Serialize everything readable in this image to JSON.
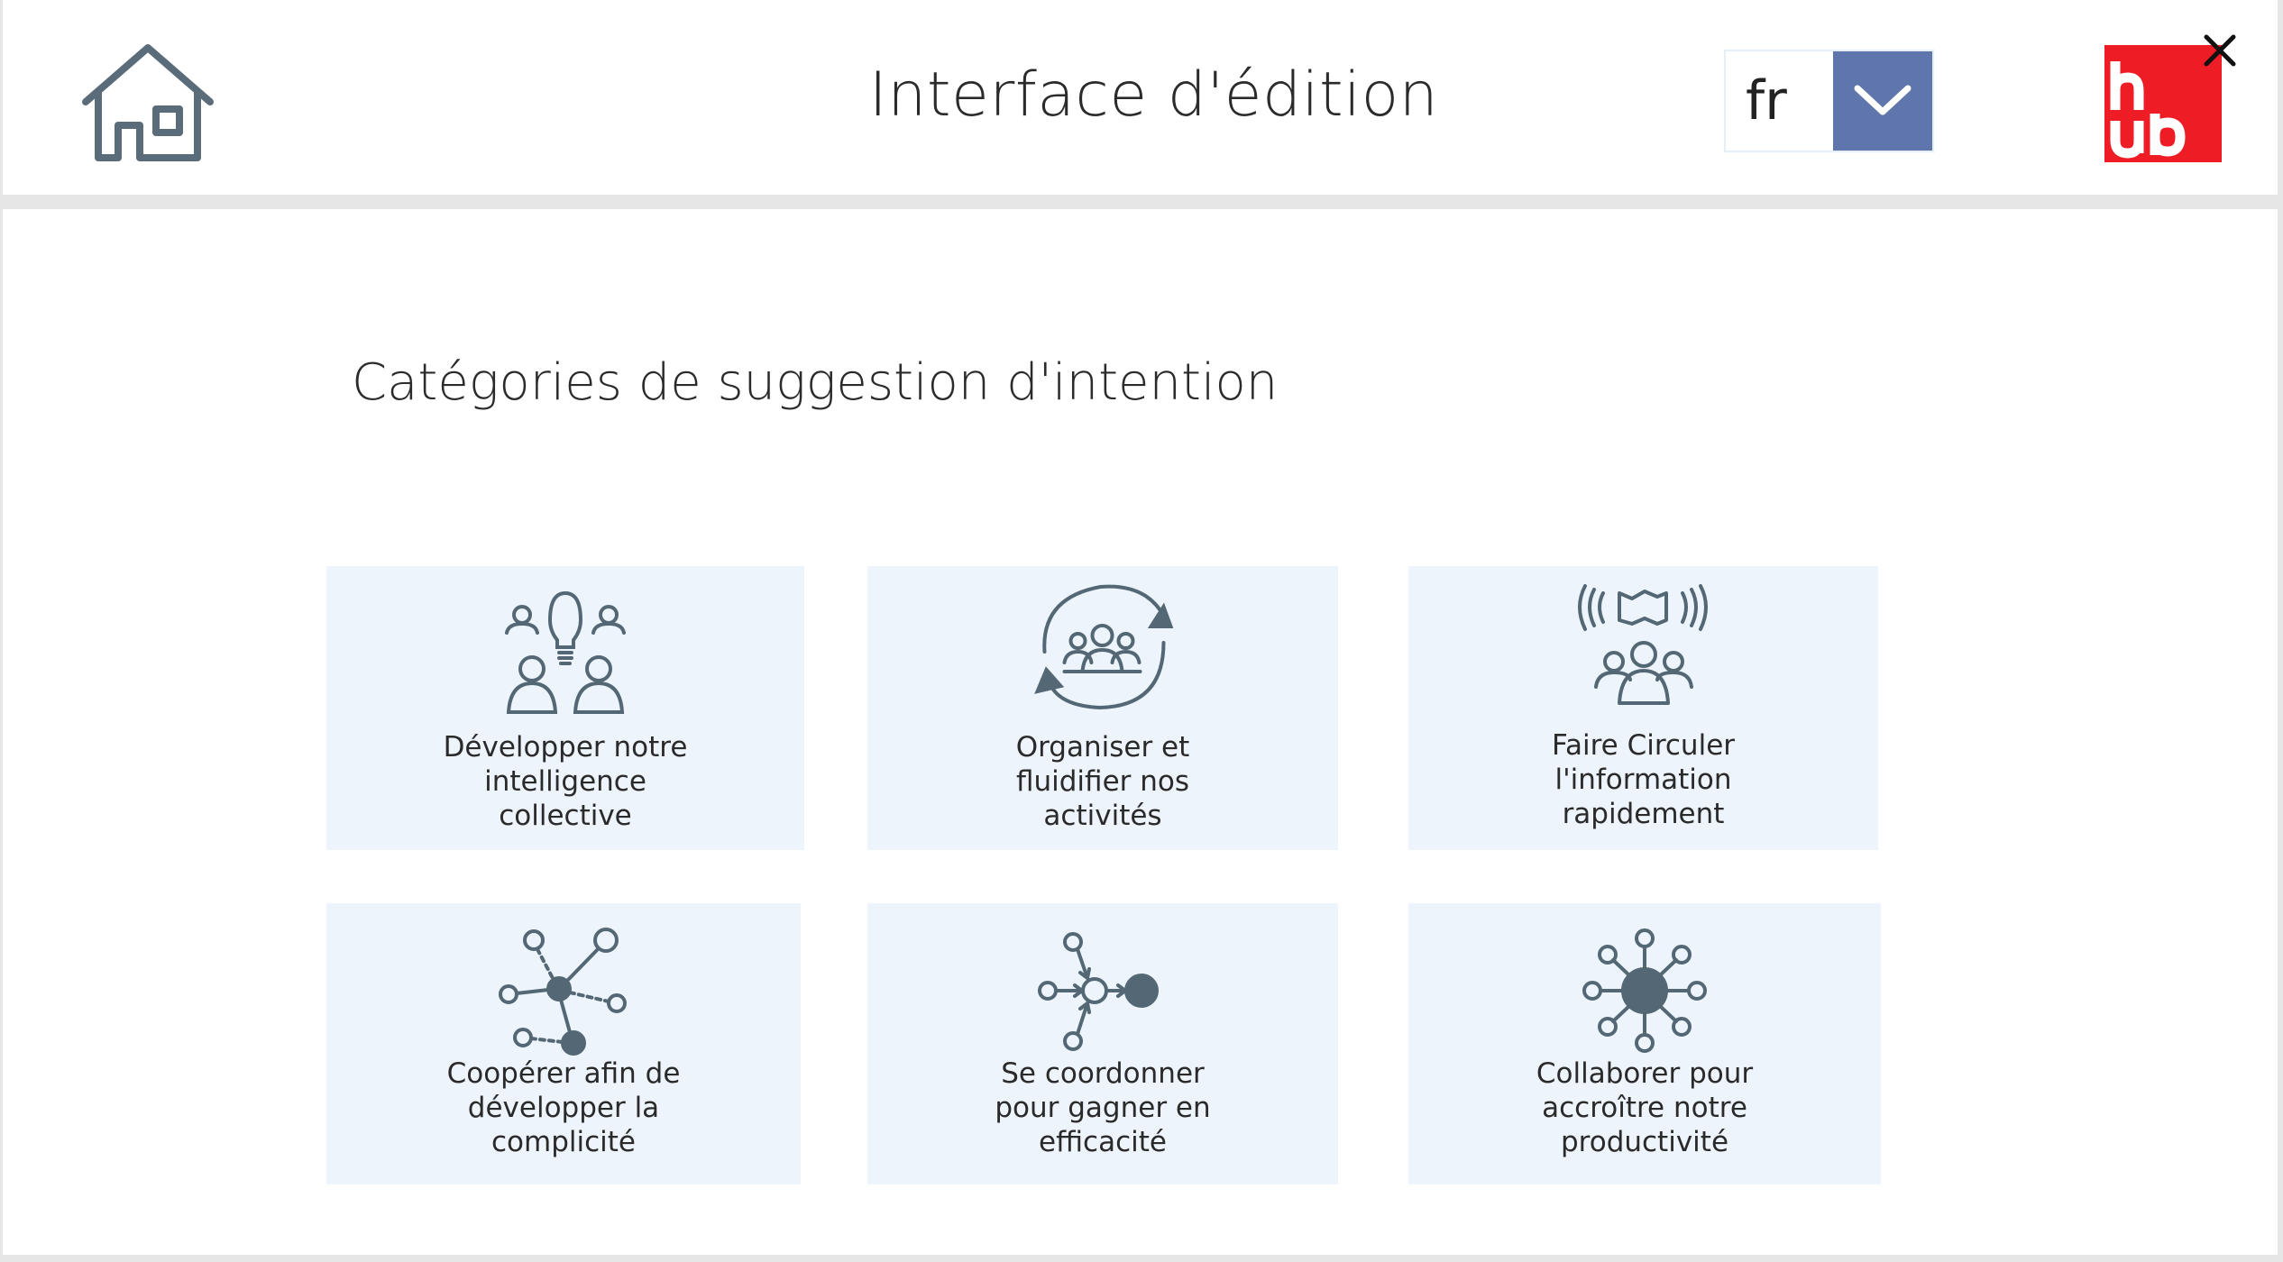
{
  "header": {
    "title": "Interface d'édition",
    "language": {
      "selected": "fr"
    },
    "logo_text": "hub"
  },
  "main": {
    "section_title": "Catégories de suggestion d'intention",
    "categories": [
      {
        "label": "Développer notre\nintelligence\ncollective",
        "icon": "collective-intelligence-icon"
      },
      {
        "label": "Organiser et\nfluidifier nos\nactivités",
        "icon": "organize-cycle-icon"
      },
      {
        "label": "Faire Circuler\nl'information\nrapidement",
        "icon": "broadcast-info-icon"
      },
      {
        "label": "Coopérer afin de\ndévelopper la\ncomplicité",
        "icon": "cooperate-network-icon"
      },
      {
        "label": "Se coordonner\npour gagner en\nefficacité",
        "icon": "coordinate-flow-icon"
      },
      {
        "label": "Collaborer pour\naccroître notre\nproductivité",
        "icon": "collaborate-hub-icon"
      }
    ]
  },
  "colors": {
    "accent": "#5f76ac",
    "card_bg": "#edf4fb",
    "icon": "#546775",
    "logo_bg": "#ee1c25"
  }
}
